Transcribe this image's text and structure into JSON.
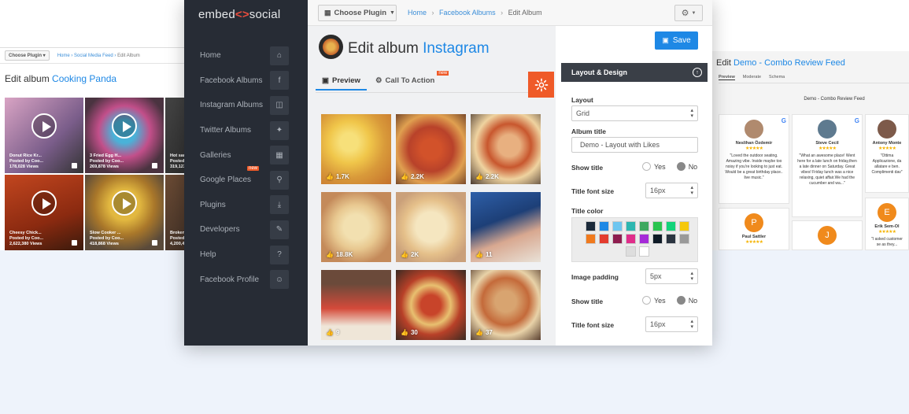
{
  "left_window": {
    "choose_label": "Choose Plugin ▾",
    "breadcrumb": [
      "Home",
      "Social Media Feed",
      "Edit Album"
    ],
    "title_prefix": "Edit album",
    "title_accent": "Cooking Panda",
    "videos": [
      {
        "caption": "Donut Rice Kr...",
        "sub": "Posted by Coo...",
        "views": "178,028 Views"
      },
      {
        "caption": "3 Fried Egg H...",
        "sub": "Posted by Coo...",
        "views": "269,878 Views"
      },
      {
        "caption": "Hot sauc...",
        "sub": "Posted b...",
        "views": "319,123..."
      },
      {
        "caption": "Cheesy Chick...",
        "sub": "Posted by Coo...",
        "views": "2,622,380 Views"
      },
      {
        "caption": "Slow Cooker ...",
        "sub": "Posted by Coo...",
        "views": "418,868 Views"
      },
      {
        "caption": "Broken ...",
        "sub": "Posted b...",
        "views": "4,200,47..."
      }
    ]
  },
  "right_window": {
    "title_prefix": "Edit",
    "title_accent": "Demo - Combo Review Feed",
    "tabs": [
      "Preview",
      "Moderate",
      "Schema"
    ],
    "demo_heading": "Demo - Combo Review Feed",
    "reviews": [
      {
        "name": "Neslihan Özdemir",
        "stars": "★★★★★",
        "text": "\"Loved the outdoor seating. Amazing vibe. Inside maybe too noisy if you're looking to just eat. Would be a great birthday place.. live music.\""
      },
      {
        "name": "Steve Cecil",
        "stars": "★★★★★",
        "text": "\"What an awesome place! Went here for a late lunch on friday,then a late dinner on Saturday. Great vibes! Friday lunch was a nice relaxing, quiet affair.We had the cucumber and wa...\""
      },
      {
        "name": "Antony Monte",
        "stars": "★★★★★",
        "text": "\"Ottima Applicazione, da allatare e ben. Complimenti dav\""
      },
      {
        "name": "Paul Sattler",
        "initial": "P",
        "stars": "★★★★★"
      },
      {
        "name": "",
        "initial": "J"
      },
      {
        "name": "Erik Sem-Ol",
        "initial": "E",
        "stars": "★★★★★",
        "text": "\"I asked customer se as they..."
      }
    ]
  },
  "sidebar": {
    "logo_a": "embed",
    "logo_sym": "<>",
    "logo_b": "social",
    "items": [
      {
        "label": "Home",
        "icon": "⌂"
      },
      {
        "label": "Facebook Albums",
        "icon": "f"
      },
      {
        "label": "Instagram Albums",
        "icon": "◫"
      },
      {
        "label": "Twitter Albums",
        "icon": "✦"
      },
      {
        "label": "Galleries",
        "icon": "▦"
      },
      {
        "label": "Google Places",
        "icon": "⚲",
        "badge": "new"
      },
      {
        "label": "Plugins",
        "icon": "⤓"
      },
      {
        "label": "Developers",
        "icon": "✎"
      },
      {
        "label": "Help",
        "icon": "?"
      },
      {
        "label": "Facebook Profile",
        "icon": "☺"
      }
    ]
  },
  "toolbar": {
    "choose_plugin": "Choose Plugin",
    "breadcrumb_home": "Home",
    "breadcrumb_albums": "Facebook Albums",
    "breadcrumb_current": "Edit Album",
    "breadcrumb_sep": "›"
  },
  "album": {
    "title_prefix": "Edit album",
    "title_accent": "Instagram",
    "tab_preview": "Preview",
    "tab_cta": "Call To Action",
    "tab_cta_badge": "new",
    "photos": [
      {
        "likes": "1.7K"
      },
      {
        "likes": "2.2K"
      },
      {
        "likes": "2.2K"
      },
      {
        "likes": "18.8K"
      },
      {
        "likes": "2K"
      },
      {
        "likes": "11"
      },
      {
        "likes": "9"
      },
      {
        "likes": "30"
      },
      {
        "likes": "37"
      }
    ]
  },
  "panel": {
    "save_label": "Save",
    "section_title": "Layout & Design",
    "layout_label": "Layout",
    "layout_value": "Grid",
    "album_title_label": "Album title",
    "album_title_value": "Demo - Layout with Likes",
    "show_title_label": "Show title",
    "yes": "Yes",
    "no": "No",
    "title_font_size_label": "Title font size",
    "title_font_size_value": "16px",
    "title_color_label": "Title color",
    "image_padding_label": "Image padding",
    "image_padding_value": "5px",
    "show_title_label_2": "Show title",
    "title_font_size_label_2": "Title font size",
    "title_font_size_value_2": "16px",
    "swatches": [
      [
        "#1b2a3a",
        "#1e88e5",
        "#6ec6f0",
        "#2db6b0",
        "#3ea85f",
        "#29c44f",
        "#12d37a",
        "#f5c80b"
      ],
      [
        "#f07a1e",
        "#e33b2e",
        "#8e1d4f",
        "#e02d8a",
        "#a52ad8",
        "#0e1a26",
        "#2a3440",
        "#999999"
      ],
      [
        "#dddddd",
        "#ffffff"
      ]
    ]
  }
}
